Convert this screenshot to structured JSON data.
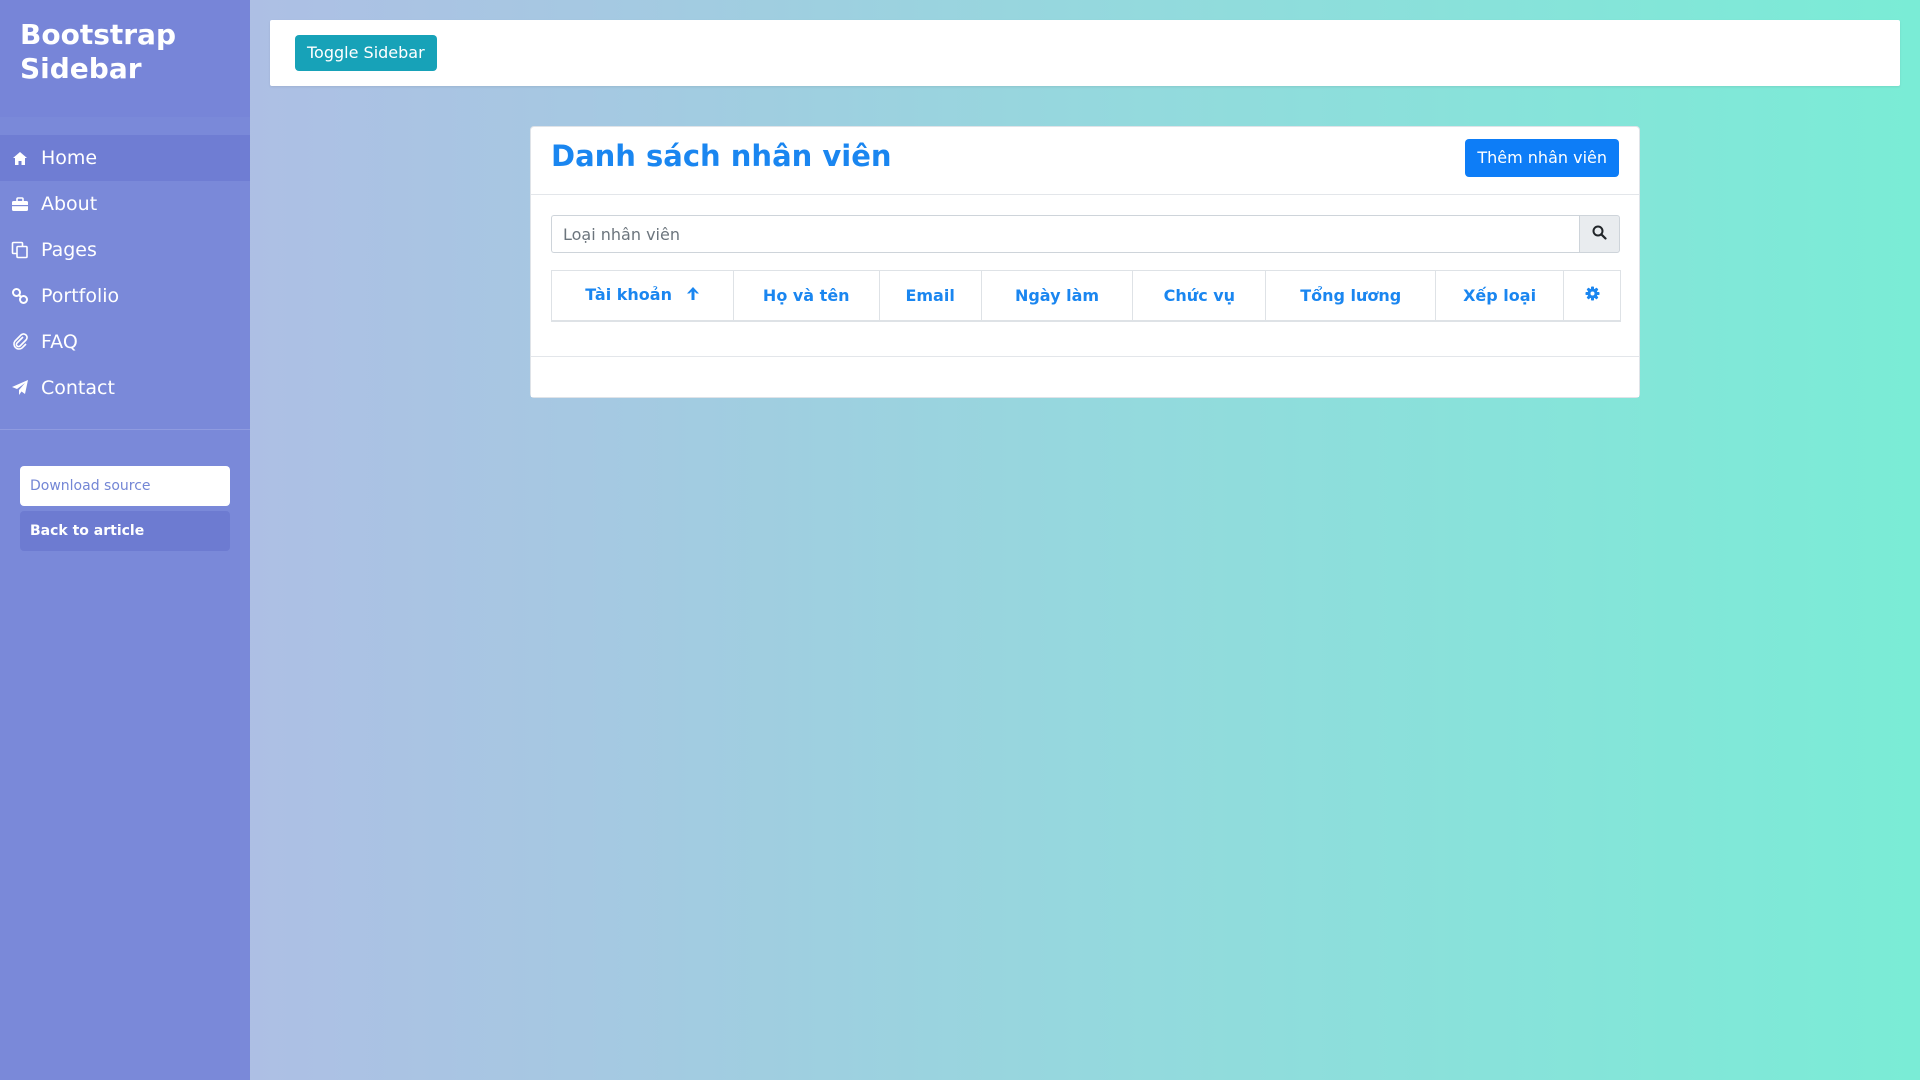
{
  "sidebar": {
    "brand": "Bootstrap Sidebar",
    "items": [
      {
        "label": "Home",
        "icon": "home-icon"
      },
      {
        "label": "About",
        "icon": "briefcase-icon"
      },
      {
        "label": "Pages",
        "icon": "copy-icon"
      },
      {
        "label": "Portfolio",
        "icon": "link-icon"
      },
      {
        "label": "FAQ",
        "icon": "paperclip-icon"
      },
      {
        "label": "Contact",
        "icon": "paper-plane-icon"
      }
    ],
    "download_label": "Download source",
    "back_label": "Back to article"
  },
  "topbar": {
    "toggle_label": "Toggle Sidebar"
  },
  "card": {
    "title": "Danh sách nhân viên",
    "add_button": "Thêm nhân viên",
    "search_placeholder": "Loại nhân viên",
    "search_icon": "search-icon",
    "columns": [
      "Tài khoản",
      "Họ và tên",
      "Email",
      "Ngày làm",
      "Chức vụ",
      "Tổng lương",
      "Xếp loại"
    ],
    "sort_icon": "arrow-up-icon",
    "settings_icon": "gear-icon"
  },
  "colors": {
    "accent": "#1a86f0",
    "sidebar": "#7a89d9",
    "toggle": "#17a2b8",
    "add_button": "#0d7df7"
  }
}
